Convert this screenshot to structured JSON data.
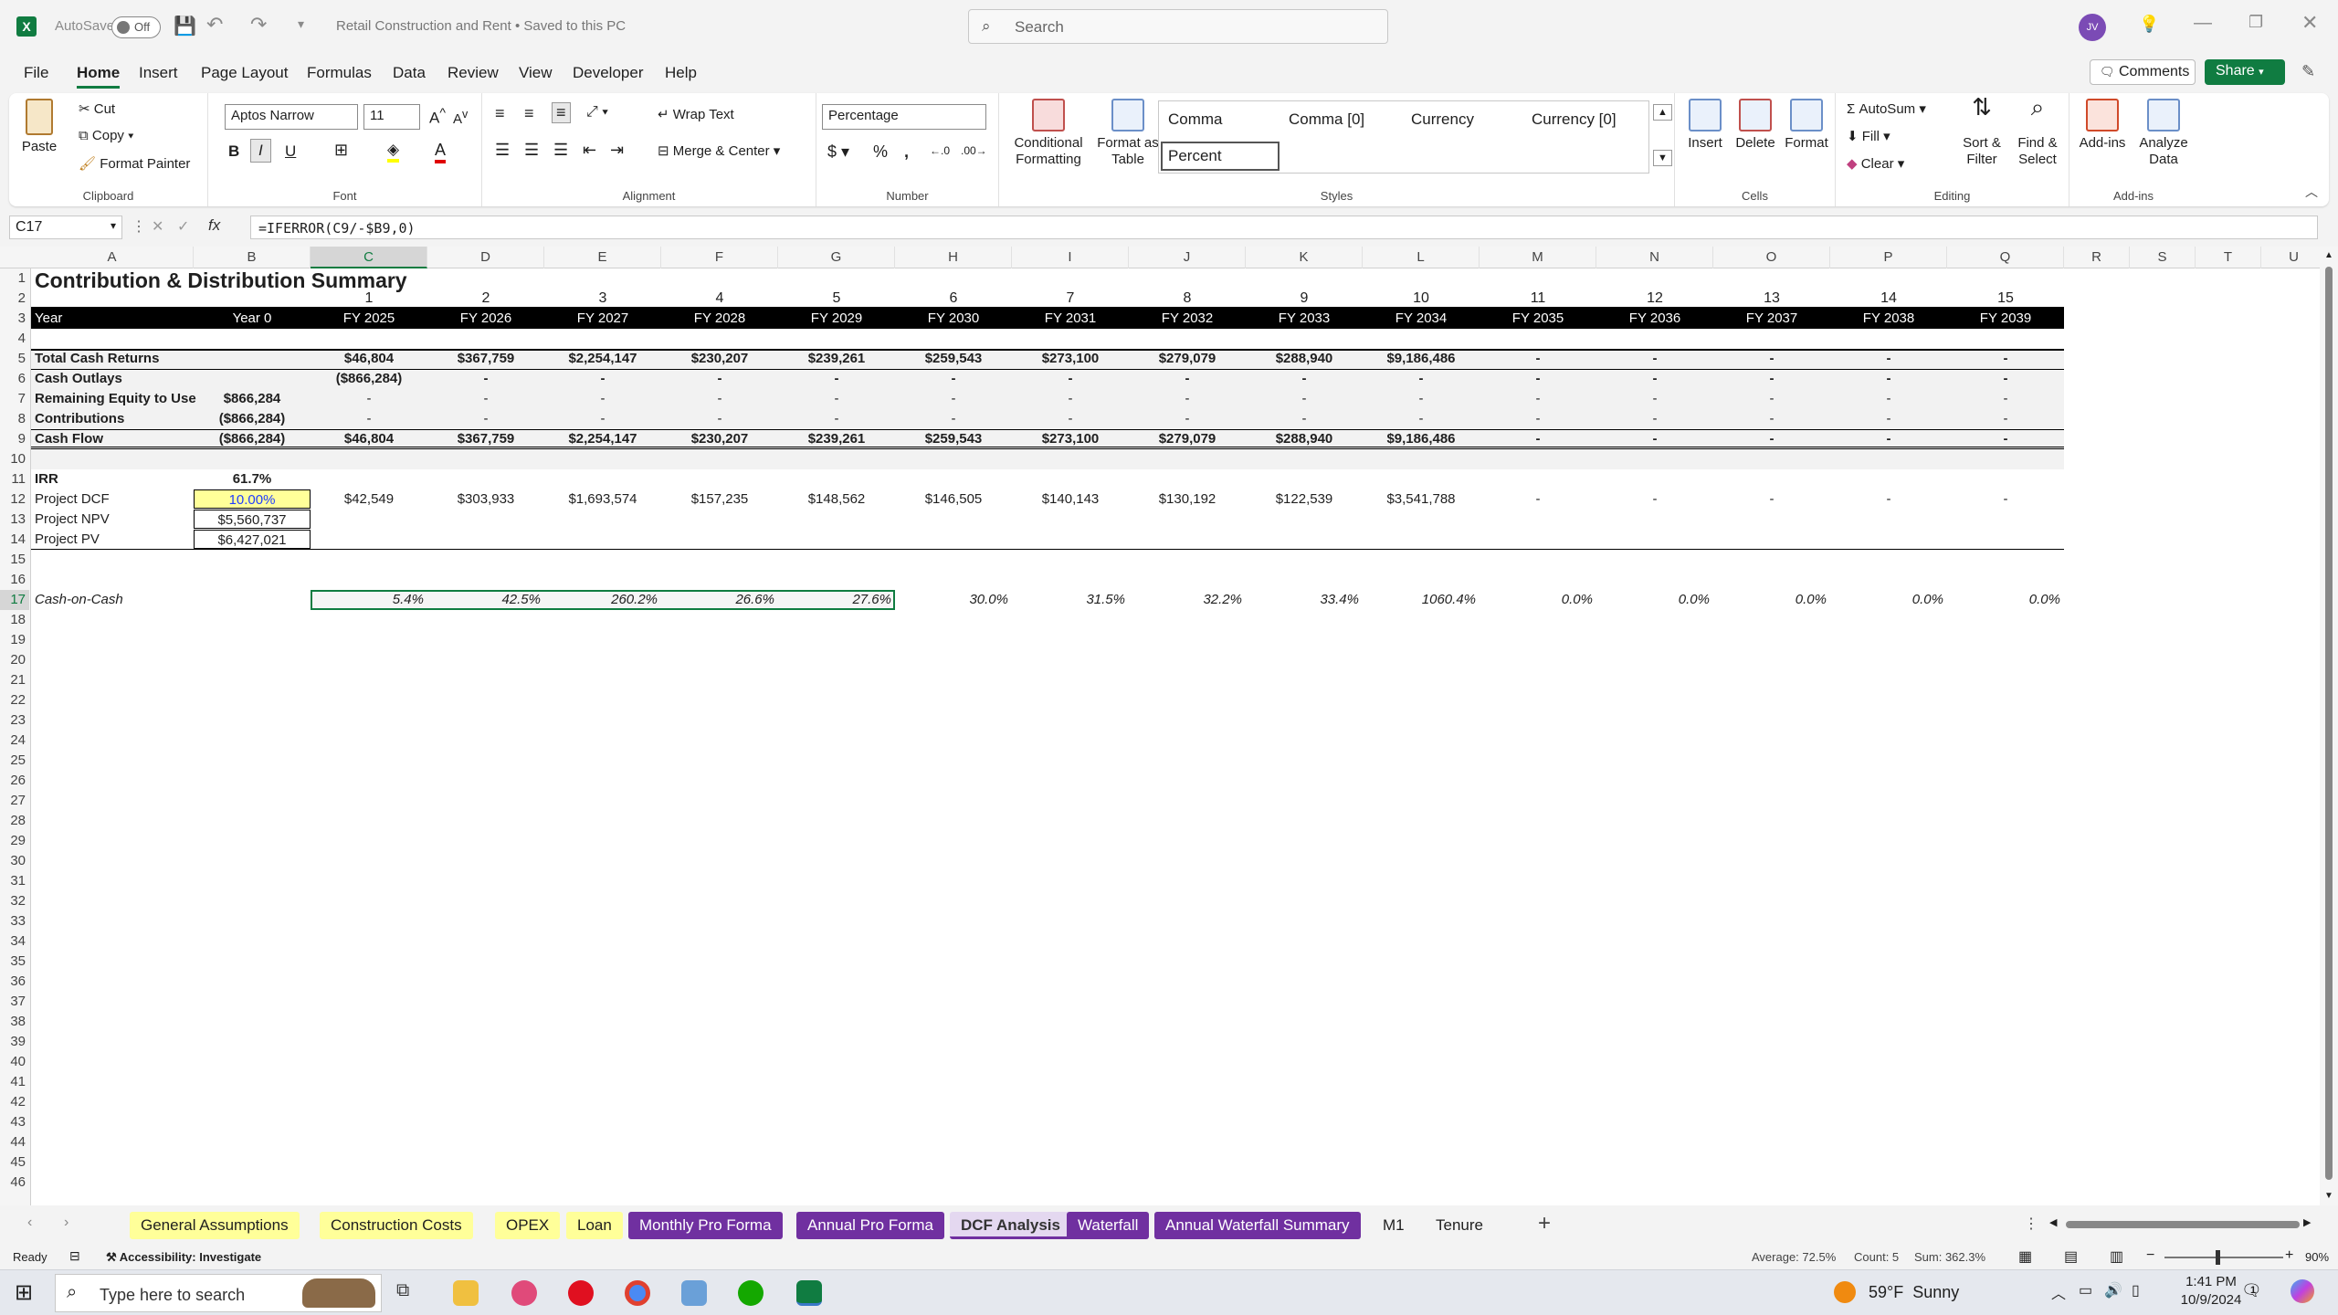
{
  "app": {
    "autosave_label": "AutoSave",
    "autosave_state": "Off",
    "doc_title": "Retail Construction and Rent • Saved to this PC",
    "search_placeholder": "Search",
    "avatar": "JV"
  },
  "menu": [
    "File",
    "Home",
    "Insert",
    "Page Layout",
    "Formulas",
    "Data",
    "Review",
    "View",
    "Developer",
    "Help"
  ],
  "menu_right": {
    "comments": "Comments",
    "share": "Share"
  },
  "ribbon": {
    "clipboard": {
      "paste": "Paste",
      "cut": "Cut",
      "copy": "Copy",
      "format_painter": "Format Painter",
      "label": "Clipboard"
    },
    "font": {
      "name": "Aptos Narrow",
      "size": "11",
      "label": "Font"
    },
    "alignment": {
      "wrap": "Wrap Text",
      "merge": "Merge & Center",
      "label": "Alignment"
    },
    "number": {
      "format": "Percentage",
      "label": "Number"
    },
    "styles": {
      "cond": "Conditional Formatting",
      "table": "Format as Table",
      "items": [
        "Comma",
        "Comma [0]",
        "Currency",
        "Currency [0]",
        "Percent"
      ],
      "label": "Styles"
    },
    "cells": {
      "insert": "Insert",
      "delete": "Delete",
      "format": "Format",
      "label": "Cells"
    },
    "editing": {
      "autosum": "AutoSum",
      "fill": "Fill",
      "clear": "Clear",
      "sort": "Sort & Filter",
      "find": "Find & Select",
      "label": "Editing"
    },
    "addins": {
      "addins": "Add-ins",
      "analyze": "Analyze Data",
      "label": "Add-ins"
    }
  },
  "formula_bar": {
    "name_box": "C17",
    "formula": "=IFERROR(C9/-$B9,0)"
  },
  "columns": [
    "A",
    "B",
    "C",
    "D",
    "E",
    "F",
    "G",
    "H",
    "I",
    "J",
    "K",
    "L",
    "M",
    "N",
    "O",
    "P",
    "Q",
    "R",
    "S",
    "T",
    "U"
  ],
  "sheet": {
    "title": "Contribution & Distribution Summary",
    "year_index": [
      "1",
      "2",
      "3",
      "4",
      "5",
      "6",
      "7",
      "8",
      "9",
      "10",
      "11",
      "12",
      "13",
      "14",
      "15"
    ],
    "year_label": "Year",
    "year0": "Year 0",
    "fy": [
      "FY 2025",
      "FY 2026",
      "FY 2027",
      "FY 2028",
      "FY 2029",
      "FY 2030",
      "FY 2031",
      "FY 2032",
      "FY 2033",
      "FY 2034",
      "FY 2035",
      "FY 2036",
      "FY 2037",
      "FY 2038",
      "FY 2039"
    ],
    "rows": [
      {
        "label": "Total Cash Returns",
        "b": "",
        "vals": [
          "$46,804",
          "$367,759",
          "$2,254,147",
          "$230,207",
          "$239,261",
          "$259,543",
          "$273,100",
          "$279,079",
          "$288,940",
          "$9,186,486",
          "-",
          "-",
          "-",
          "-",
          "-"
        ]
      },
      {
        "label": "Cash Outlays",
        "b": "",
        "vals": [
          "($866,284)",
          "-",
          "-",
          "-",
          "-",
          "-",
          "-",
          "-",
          "-",
          "-",
          "-",
          "-",
          "-",
          "-",
          "-"
        ]
      },
      {
        "label": "Remaining Equity to Use",
        "b": "$866,284",
        "vals": [
          "-",
          "-",
          "-",
          "-",
          "-",
          "-",
          "-",
          "-",
          "-",
          "-",
          "-",
          "-",
          "-",
          "-",
          "-"
        ]
      },
      {
        "label": "Contributions",
        "b": "($866,284)",
        "vals": [
          "-",
          "-",
          "-",
          "-",
          "-",
          "-",
          "-",
          "-",
          "-",
          "-",
          "-",
          "-",
          "-",
          "-",
          "-"
        ]
      },
      {
        "label": "Cash Flow",
        "b": "($866,284)",
        "vals": [
          "$46,804",
          "$367,759",
          "$2,254,147",
          "$230,207",
          "$239,261",
          "$259,543",
          "$273,100",
          "$279,079",
          "$288,940",
          "$9,186,486",
          "-",
          "-",
          "-",
          "-",
          "-"
        ]
      }
    ],
    "irr_label": "IRR",
    "irr": "61.7%",
    "dcf_label": "Project DCF",
    "dcf_rate": "10.00%",
    "dcf_vals": [
      "$42,549",
      "$303,933",
      "$1,693,574",
      "$157,235",
      "$148,562",
      "$146,505",
      "$140,143",
      "$130,192",
      "$122,539",
      "$3,541,788",
      "-",
      "-",
      "-",
      "-",
      "-"
    ],
    "npv_label": "Project NPV",
    "npv": "$5,560,737",
    "pv_label": "Project PV",
    "pv": "$6,427,021",
    "coc_label": "Cash-on-Cash",
    "coc": [
      "5.4%",
      "42.5%",
      "260.2%",
      "26.6%",
      "27.6%",
      "30.0%",
      "31.5%",
      "32.2%",
      "33.4%",
      "1060.4%",
      "0.0%",
      "0.0%",
      "0.0%",
      "0.0%",
      "0.0%"
    ]
  },
  "tabs": [
    {
      "name": "General Assumptions",
      "color": "#ffff99"
    },
    {
      "name": "Construction Costs",
      "color": "#ffff99"
    },
    {
      "name": "OPEX",
      "color": "#ffff99"
    },
    {
      "name": "Loan",
      "color": "#ffff99"
    },
    {
      "name": "Monthly Pro Forma",
      "color": "#7030a0"
    },
    {
      "name": "Annual Pro Forma",
      "color": "#7030a0"
    },
    {
      "name": "DCF Analysis",
      "color": "#e4d8f0"
    },
    {
      "name": "Waterfall",
      "color": "#7030a0"
    },
    {
      "name": "Annual Waterfall Summary",
      "color": "#7030a0"
    },
    {
      "name": "M1",
      "color": ""
    },
    {
      "name": "Tenure",
      "color": ""
    }
  ],
  "status": {
    "ready": "Ready",
    "accessibility": "Accessibility: Investigate",
    "average": "Average: 72.5%",
    "count": "Count: 5",
    "sum": "Sum: 362.3%",
    "zoom": "90%"
  },
  "taskbar": {
    "search": "Type here to search",
    "weather": "59°F  Sunny",
    "time": "1:41 PM",
    "date": "10/9/2024",
    "notif": "1"
  }
}
